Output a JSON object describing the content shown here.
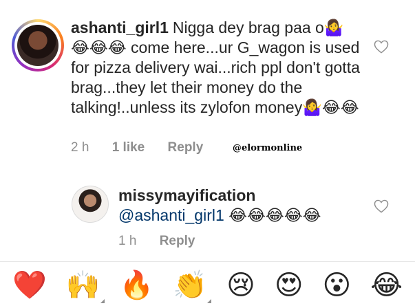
{
  "comments": [
    {
      "username": "ashanti_girl1",
      "text": "Nigga dey brag paa o🤷‍♀️😂😂😂 come  here...ur G_wagon  is used for pizza delivery wai...rich ppl don't gotta brag...they let their money do the talking!..unless its zylofon money🤷‍♀️😂😂",
      "time": "2 h",
      "likes": "1 like",
      "reply_label": "Reply"
    },
    {
      "username": "missymayification",
      "mention": "@ashanti_girl1",
      "text": "😂😂😂😂😂",
      "time": "1 h",
      "reply_label": "Reply"
    }
  ],
  "watermark": "@elormonline",
  "reactions": [
    {
      "emoji": "❤️",
      "name": "heart"
    },
    {
      "emoji": "🙌",
      "name": "raised-hands"
    },
    {
      "emoji": "🔥",
      "name": "fire"
    },
    {
      "emoji": "👏",
      "name": "clapping-hands"
    },
    {
      "emoji": "😢",
      "name": "crying-face"
    },
    {
      "emoji": "😍",
      "name": "heart-eyes"
    },
    {
      "emoji": "😮",
      "name": "surprised-face"
    },
    {
      "emoji": "😂",
      "name": "tears-of-joy"
    }
  ],
  "colors": {
    "text": "#262626",
    "meta": "#8e8e8e",
    "mention": "#003569",
    "like_heart": "#ed4956"
  }
}
